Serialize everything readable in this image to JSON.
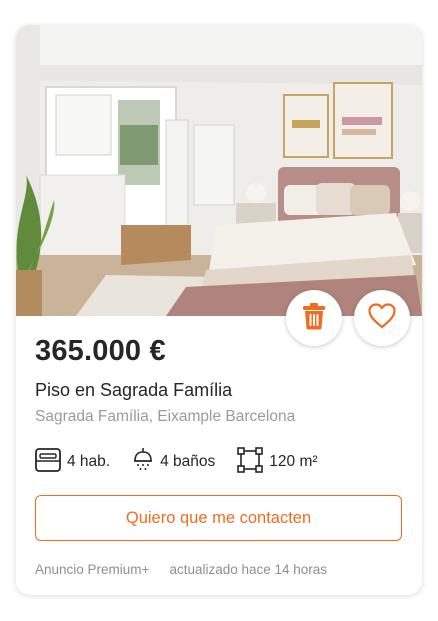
{
  "listing": {
    "price": "365.000 €",
    "title": "Piso en Sagrada Família",
    "location": "Sagrada Família, Eixample Barcelona",
    "photo_icon": "bedroom-photo"
  },
  "actions": {
    "delete_icon": "trash-icon",
    "favorite_icon": "heart-icon"
  },
  "features": {
    "rooms": "4 hab.",
    "baths": "4 baños",
    "area": "120 m²"
  },
  "contact_button": "Quiero que me contacten",
  "footer": {
    "badge": "Anuncio Premium+",
    "updated": "actualizado hace 14 horas"
  },
  "colors": {
    "accent": "#ef6c20",
    "text": "#262626",
    "muted": "#9b9b9b"
  }
}
